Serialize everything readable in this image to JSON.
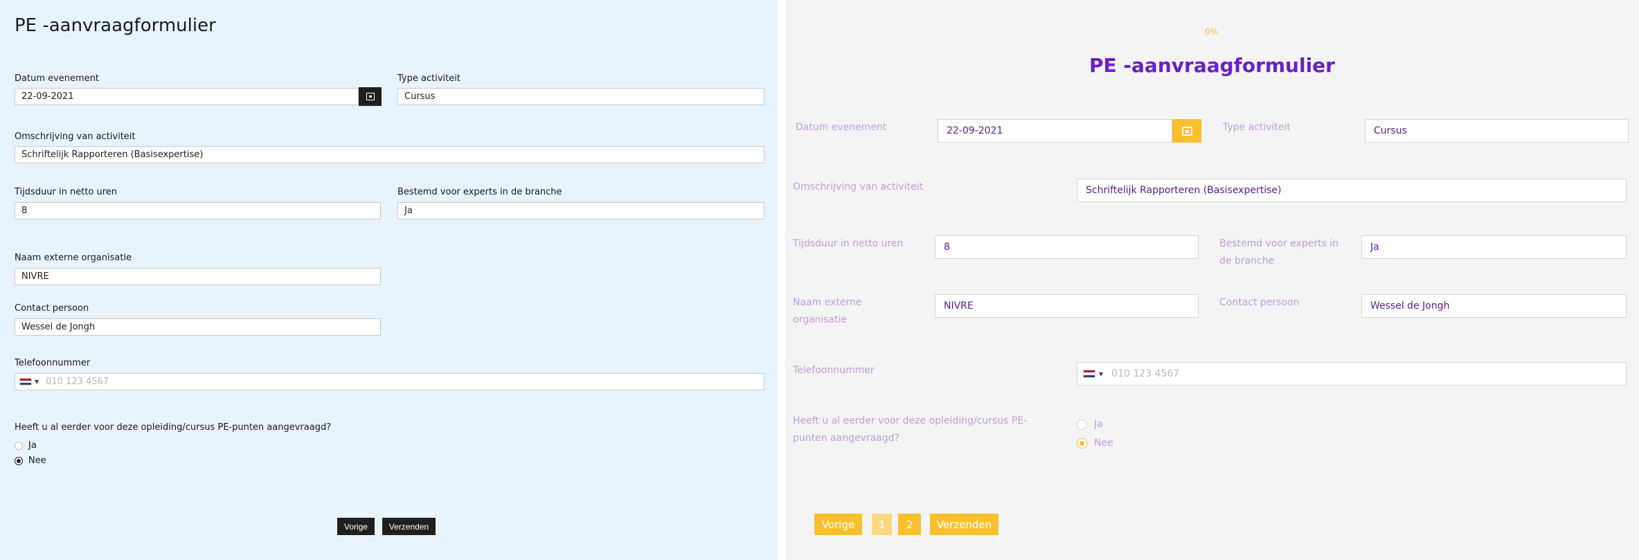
{
  "left": {
    "title": "PE -aanvraagformulier",
    "datum_label": "Datum evenement",
    "datum_value": "22-09-2021",
    "type_label": "Type activiteit",
    "type_value": "Cursus",
    "omschrijving_label": "Omschrijving van activiteit",
    "omschrijving_value": "Schriftelijk Rapporteren (Basisexpertise)",
    "tijdsduur_label": "Tijdsduur in netto uren",
    "tijdsduur_value": "8",
    "bestemd_label": "Bestemd voor experts in de branche",
    "bestemd_value": "Ja",
    "naam_label": "Naam externe organisatie",
    "naam_value": "NIVRE",
    "contact_label": "Contact persoon",
    "contact_value": "Wessel de Jongh",
    "telefoon_label": "Telefoonnummer",
    "telefoon_placeholder": "010 123 4567",
    "question": "Heeft u al eerder voor deze opleiding/cursus PE-punten aangevraagd?",
    "radio_ja": "Ja",
    "radio_nee": "Nee",
    "selected": "Nee",
    "btn_prev": "Vorige",
    "btn_submit": "Verzenden"
  },
  "right": {
    "progress": "0%",
    "title": "PE -aanvraagformulier",
    "datum_label": "Datum evenement",
    "datum_value": "22-09-2021",
    "type_label": "Type activiteit",
    "type_value": "Cursus",
    "omschrijving_label": "Omschrijving van activiteit",
    "omschrijving_value": "Schriftelijk Rapporteren (Basisexpertise)",
    "tijdsduur_label": "Tijdsduur in netto uren",
    "tijdsduur_value": "8",
    "bestemd_label": "Bestemd voor experts in de branche",
    "bestemd_value": "Ja",
    "naam_label": "Naam externe organisatie",
    "naam_value": "NIVRE",
    "contact_label": "Contact persoon",
    "contact_value": "Wessel de Jongh",
    "telefoon_label": "Telefoonnummer",
    "telefoon_placeholder": "010 123 4567",
    "question": "Heeft u al eerder voor deze opleiding/cursus PE-punten aangevraagd?",
    "radio_ja": "Ja",
    "radio_nee": "Nee",
    "selected": "Nee",
    "btn_prev": "Vorige",
    "page_1": "1",
    "page_2": "2",
    "btn_submit": "Verzenden"
  },
  "colors": {
    "left_bg": "#e8f4fd",
    "right_bg": "#f4f4f4",
    "accent_yellow": "#fbc02d",
    "title_purple": "#6a1fc9",
    "label_lilac": "#c29ed9",
    "dark_button": "#1f1f1f"
  },
  "icons": {
    "calendar": "calendar-icon",
    "flag": "netherlands-flag-icon",
    "dropdown": "chevron-down-icon"
  }
}
